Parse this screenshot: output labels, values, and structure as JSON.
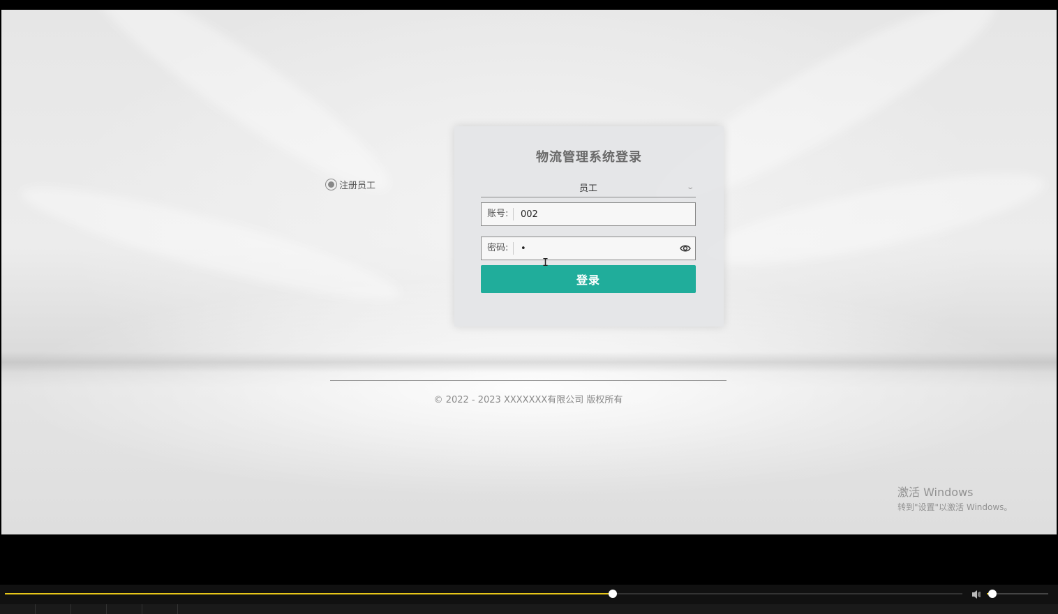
{
  "login": {
    "title": "物流管理系统登录",
    "role_selected": "员工",
    "account_label": "账号:",
    "account_value": "002",
    "password_label": "密码:",
    "password_value": "•",
    "login_button": "登录"
  },
  "register": {
    "label": "注册员工"
  },
  "footer": {
    "copyright": "© 2022 - 2023 XXXXXXX有限公司 版权所有"
  },
  "watermark": {
    "title": "激活 Windows",
    "subtitle": "转到\"设置\"以激活 Windows。"
  },
  "player": {
    "progress_percent": 63.5,
    "volume_percent": 9
  },
  "colors": {
    "accent": "#20ad9b",
    "progress": "#e6c619"
  },
  "icons": {
    "eye": "eye-icon",
    "chevron": "chevron-down-icon",
    "volume": "volume-icon"
  }
}
